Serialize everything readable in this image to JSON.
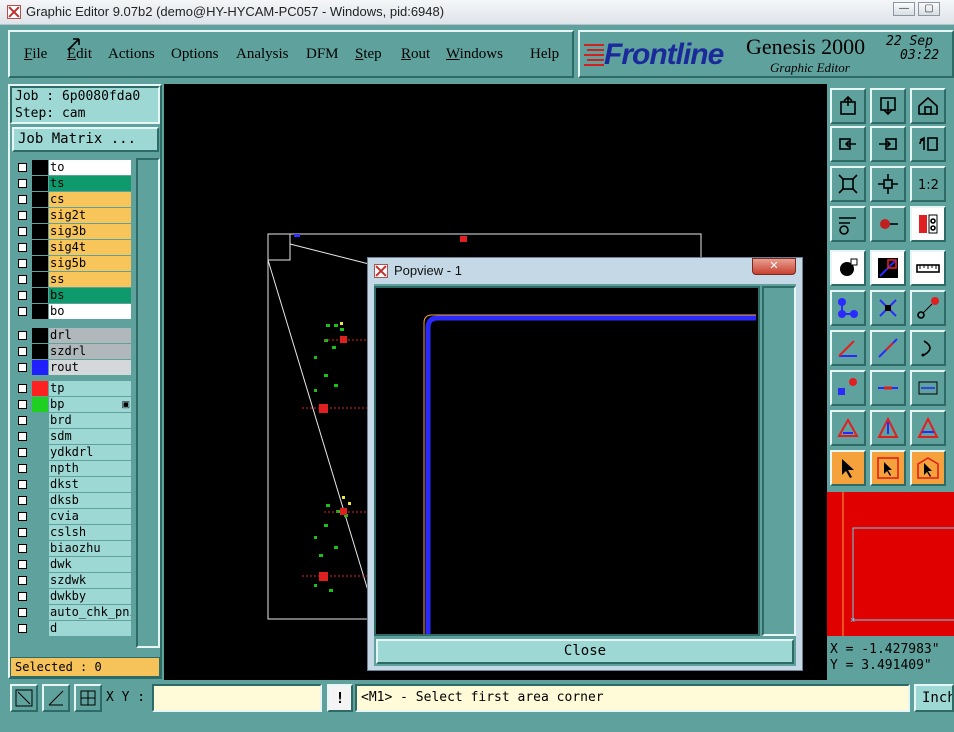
{
  "window": {
    "title": "Graphic Editor 9.07b2 (demo@HY-HYCAM-PC057 - Windows, pid:6948)",
    "minimize_label": "—",
    "maximize_label": "▢"
  },
  "menubar": {
    "items": [
      "File",
      "Edit",
      "Actions",
      "Options",
      "Analysis",
      "DFM",
      "Step",
      "Rout",
      "Windows",
      "Help"
    ]
  },
  "brand": {
    "logo_text": "Frontline",
    "product": "Genesis 2000",
    "subtitle": "Graphic Editor",
    "date": "22 Sep",
    "time": "03:22"
  },
  "job_panel": {
    "job": "Job : 6p0080fda0",
    "step": "Step: cam",
    "job_matrix_label": "Job Matrix ..."
  },
  "layers": {
    "board": [
      {
        "name": "to",
        "color": "#ffffff",
        "swatch": "#000000"
      },
      {
        "name": "ts",
        "color": "#0f9a6e",
        "swatch": "#000000"
      },
      {
        "name": "cs",
        "color": "#f7c55a",
        "swatch": "#000000"
      },
      {
        "name": "sig2t",
        "color": "#f7c55a",
        "swatch": "#000000"
      },
      {
        "name": "sig3b",
        "color": "#f7c55a",
        "swatch": "#000000"
      },
      {
        "name": "sig4t",
        "color": "#f7c55a",
        "swatch": "#000000"
      },
      {
        "name": "sig5b",
        "color": "#f7c55a",
        "swatch": "#000000"
      },
      {
        "name": "ss",
        "color": "#f7c55a",
        "swatch": "#000000"
      },
      {
        "name": "bs",
        "color": "#0f9a6e",
        "swatch": "#000000"
      },
      {
        "name": "bo",
        "color": "#ffffff",
        "swatch": "#000000"
      }
    ],
    "drill": [
      {
        "name": "drl",
        "color": "#b0b8bc",
        "swatch": "#000000"
      },
      {
        "name": "szdrl",
        "color": "#b0b8bc",
        "swatch": "#000000"
      },
      {
        "name": "rout",
        "color": "#d4d8da",
        "swatch": "#2020ff"
      }
    ],
    "misc": [
      {
        "name": "tp",
        "color": "#9ed8d4",
        "swatch": "#ff2020"
      },
      {
        "name": "bp",
        "color": "#9ed8d4",
        "swatch": "#20d020",
        "mark": "▣"
      },
      {
        "name": "brd",
        "color": "#9ed8d4",
        "swatch": "#5fa29d"
      },
      {
        "name": "sdm",
        "color": "#9ed8d4",
        "swatch": "#5fa29d"
      },
      {
        "name": "ydkdrl",
        "color": "#9ed8d4",
        "swatch": "#5fa29d"
      },
      {
        "name": "npth",
        "color": "#9ed8d4",
        "swatch": "#5fa29d"
      },
      {
        "name": "dkst",
        "color": "#9ed8d4",
        "swatch": "#5fa29d"
      },
      {
        "name": "dksb",
        "color": "#9ed8d4",
        "swatch": "#5fa29d"
      },
      {
        "name": "cvia",
        "color": "#9ed8d4",
        "swatch": "#5fa29d"
      },
      {
        "name": "cslsh",
        "color": "#9ed8d4",
        "swatch": "#5fa29d"
      },
      {
        "name": "biaozhu",
        "color": "#9ed8d4",
        "swatch": "#5fa29d"
      },
      {
        "name": "dwk",
        "color": "#9ed8d4",
        "swatch": "#5fa29d"
      },
      {
        "name": "szdwk",
        "color": "#9ed8d4",
        "swatch": "#5fa29d"
      },
      {
        "name": "dwkby",
        "color": "#9ed8d4",
        "swatch": "#5fa29d"
      },
      {
        "name": "auto_chk_pni",
        "color": "#9ed8d4",
        "swatch": "#5fa29d"
      },
      {
        "name": "d",
        "color": "#9ed8d4",
        "swatch": "#5fa29d"
      }
    ]
  },
  "selected_label": "Selected : 0",
  "popview": {
    "title": "Popview - 1",
    "close_label": "Close",
    "close_x": "✕"
  },
  "coords": {
    "x": "X = -1.427983\"",
    "y": "Y = 3.491409\""
  },
  "statusbar": {
    "xy_label": "X Y :",
    "xy_value": "",
    "warn_label": "!",
    "message": "<M1> - Select first area corner",
    "units": "Inch"
  },
  "colors": {
    "panel": "#5fa29d",
    "canvas": "#000000",
    "highlight": "#f6a23c",
    "status_bg": "#fffbd8"
  }
}
